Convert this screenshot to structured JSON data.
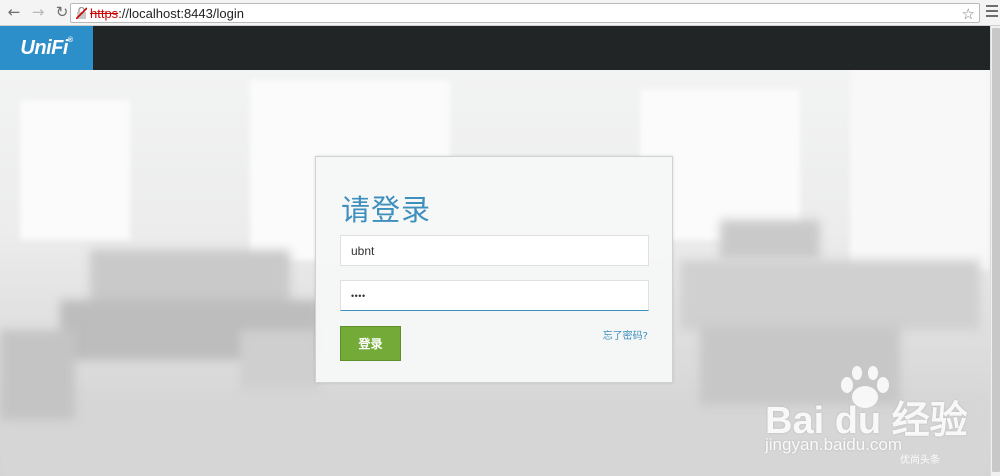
{
  "browser": {
    "back_icon": "arrow-left",
    "forward_icon": "arrow-right",
    "reload_icon": "reload",
    "url_scheme": "https",
    "url_rest": "://localhost:8443/login",
    "bookmark_icon": "star",
    "menu_icon": "hamburger"
  },
  "header": {
    "logo_text": "UniFi",
    "logo_mark": "®",
    "brand_color": "#2d8fc9",
    "bar_color": "#222526"
  },
  "login": {
    "title": "请登录",
    "username_value": "ubnt",
    "password_value": "••••",
    "submit_label": "登录",
    "forgot_label": "忘了密码?",
    "accent_color": "#3d8fbd",
    "button_color": "#74ab38"
  },
  "watermark": {
    "main": "Bai du 经验",
    "sub": "jingyan.baidu.com",
    "corner": "优尚头条"
  }
}
